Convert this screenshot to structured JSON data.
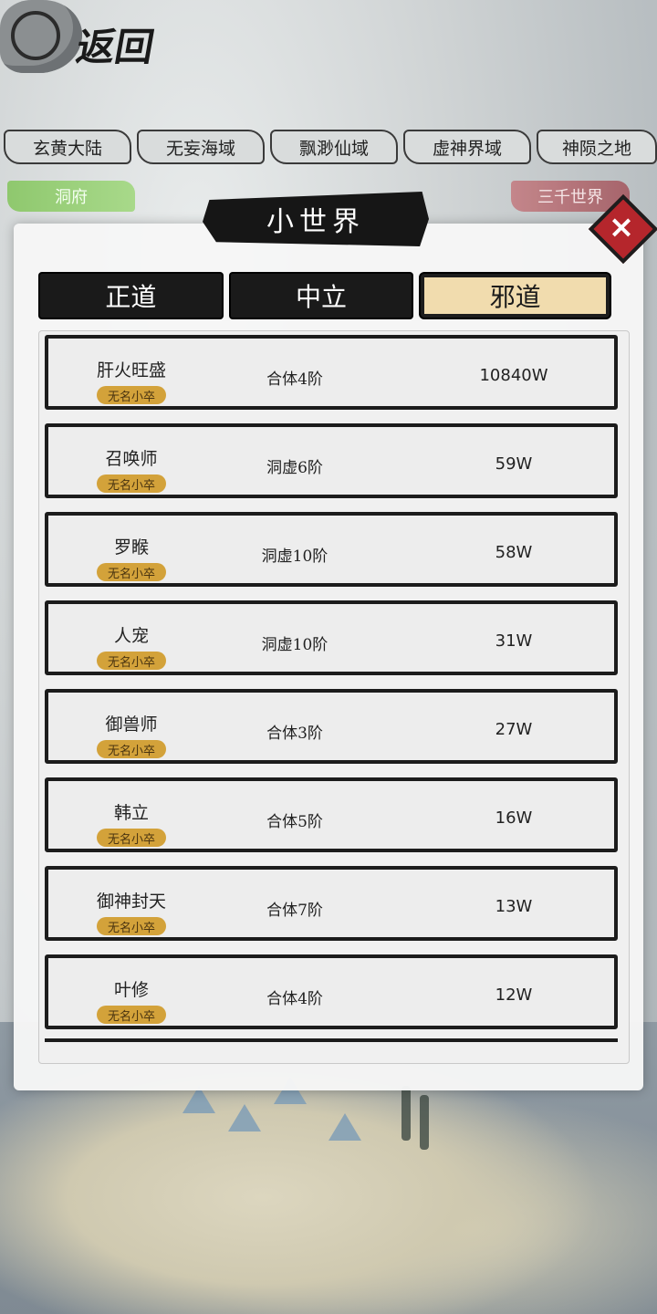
{
  "logo": {
    "title": "返回"
  },
  "regions": [
    "玄黄大陆",
    "无妄海域",
    "飘渺仙域",
    "虚神界域",
    "神陨之地"
  ],
  "side_tags": {
    "left": "洞府",
    "right": "三千世界"
  },
  "panel": {
    "title": "小世界",
    "close_label": "×",
    "tabs": [
      {
        "label": "正道"
      },
      {
        "label": "中立"
      },
      {
        "label": "邪道"
      }
    ],
    "active_tab": "邪道",
    "rows": [
      {
        "name": "肝火旺盛",
        "badge": "无名小卒",
        "realm": "合体4阶",
        "power": "10840W"
      },
      {
        "name": "召唤师",
        "badge": "无名小卒",
        "realm": "洞虚6阶",
        "power": "59W"
      },
      {
        "name": "罗睺",
        "badge": "无名小卒",
        "realm": "洞虚10阶",
        "power": "58W"
      },
      {
        "name": "人宠",
        "badge": "无名小卒",
        "realm": "洞虚10阶",
        "power": "31W"
      },
      {
        "name": "御兽师",
        "badge": "无名小卒",
        "realm": "合体3阶",
        "power": "27W"
      },
      {
        "name": "韩立",
        "badge": "无名小卒",
        "realm": "合体5阶",
        "power": "16W"
      },
      {
        "name": "御神封天",
        "badge": "无名小卒",
        "realm": "合体7阶",
        "power": "13W"
      },
      {
        "name": "叶修",
        "badge": "无名小卒",
        "realm": "合体4阶",
        "power": "12W"
      }
    ]
  }
}
